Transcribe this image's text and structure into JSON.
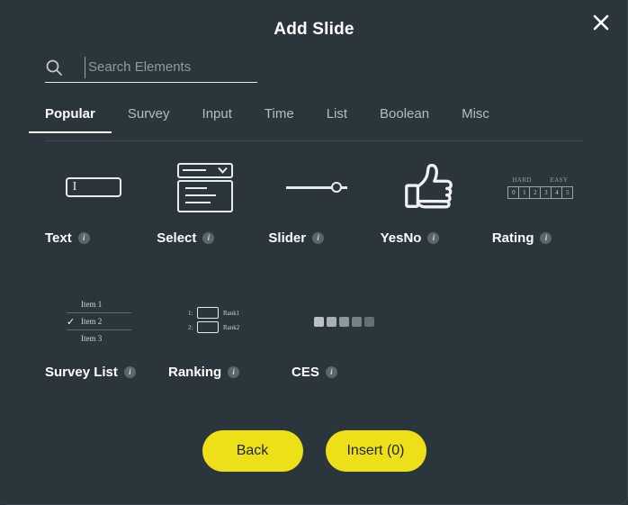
{
  "dialog": {
    "title": "Add Slide",
    "close_label": "×",
    "close_icon": "close-icon"
  },
  "search": {
    "icon": "search-icon",
    "placeholder": "Search Elements",
    "value": ""
  },
  "tabs": [
    {
      "label": "Popular",
      "active": true
    },
    {
      "label": "Survey",
      "active": false
    },
    {
      "label": "Input",
      "active": false
    },
    {
      "label": "Time",
      "active": false
    },
    {
      "label": "List",
      "active": false
    },
    {
      "label": "Boolean",
      "active": false
    },
    {
      "label": "Misc",
      "active": false
    }
  ],
  "elements": {
    "row1": [
      {
        "label": "Text",
        "icon": "text-input-icon",
        "info": "i"
      },
      {
        "label": "Select",
        "icon": "dropdown-select-icon",
        "info": "i"
      },
      {
        "label": "Slider",
        "icon": "slider-icon",
        "info": "i"
      },
      {
        "label": "YesNo",
        "icon": "thumbs-up-icon",
        "info": "i"
      },
      {
        "label": "Rating",
        "icon": "rating-scale-icon",
        "info": "i"
      }
    ],
    "row2": [
      {
        "label": "Survey List",
        "icon": "survey-list-icon",
        "info": "i"
      },
      {
        "label": "Ranking",
        "icon": "ranking-icon",
        "info": "i"
      },
      {
        "label": "CES",
        "icon": "ces-icon",
        "info": "i"
      }
    ]
  },
  "thumbs": {
    "text": {
      "caret": "I"
    },
    "rating": {
      "left_label": "HARD",
      "right_label": "EASY",
      "values": [
        "0",
        "1",
        "2",
        "3",
        "4",
        "5"
      ]
    },
    "survey_list": {
      "items": [
        "Item 1",
        "Item 2",
        "Item 3"
      ],
      "checked_index": 1,
      "check_glyph": "✓"
    },
    "ranking": {
      "rows": [
        {
          "num": "1:",
          "label": "Rank1"
        },
        {
          "num": "2:",
          "label": "Rank2"
        }
      ]
    },
    "ces": {
      "shades": [
        "#b9c2c7",
        "#a6b0b6",
        "#8e989f",
        "#76818a",
        "#646f77"
      ]
    }
  },
  "footer": {
    "back_label": "Back",
    "insert_label": "Insert (0)"
  },
  "colors": {
    "background": "#2b353c",
    "accent_yellow": "#ede019",
    "text_primary": "#ffffff",
    "text_muted": "#b5bdc3"
  }
}
